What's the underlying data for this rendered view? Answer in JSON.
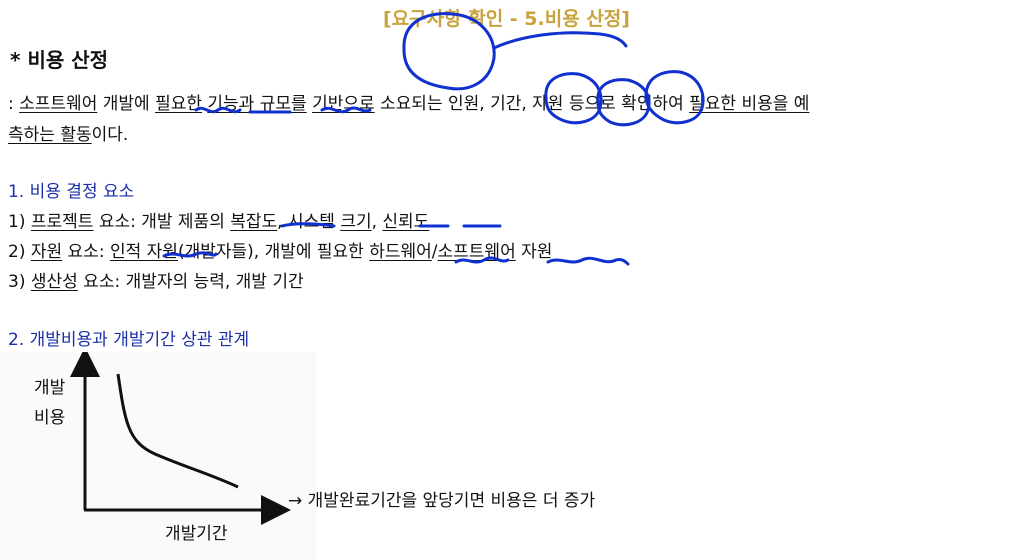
{
  "header": "[요구사항 확인 - 5.비용 산정]",
  "section": {
    "bullet": "*",
    "title": "비용 산정"
  },
  "definition": {
    "prefix": ": ",
    "line1": [
      {
        "text": "소프트웨어",
        "u": true
      },
      {
        "text": " 개발에 ",
        "u": false
      },
      {
        "text": "필요한",
        "u": true
      },
      {
        "text": " ",
        "u": false
      },
      {
        "text": "기능과",
        "u": true
      },
      {
        "text": " ",
        "u": false
      },
      {
        "text": "규모를",
        "u": true
      },
      {
        "text": " ",
        "u": false
      },
      {
        "text": "기반으로",
        "u": true
      },
      {
        "text": " 소요되는 인원, 기간, 자원 등으로 확인하여 ",
        "u": false
      },
      {
        "text": "필요한 비용을 예",
        "u": true
      }
    ],
    "line2": [
      {
        "text": "측하는 활동",
        "u": true
      },
      {
        "text": "이다.",
        "u": false
      }
    ]
  },
  "factors": {
    "heading": "1. 비용 결정 요소",
    "items": [
      [
        {
          "text": "1) ",
          "u": false
        },
        {
          "text": "프로젝트",
          "u": true
        },
        {
          "text": " 요소: 개발 제품의 ",
          "u": false
        },
        {
          "text": "복잡도",
          "u": true
        },
        {
          "text": ", 시스템 ",
          "u": false
        },
        {
          "text": "크기",
          "u": true
        },
        {
          "text": ", ",
          "u": false
        },
        {
          "text": "신뢰도",
          "u": true
        }
      ],
      [
        {
          "text": "2) ",
          "u": false
        },
        {
          "text": "자원",
          "u": true
        },
        {
          "text": "  요소: ",
          "u": false
        },
        {
          "text": "인적 자원",
          "u": true
        },
        {
          "text": "(개발자들), 개발에 필요한 ",
          "u": false
        },
        {
          "text": "하드웨어",
          "u": true
        },
        {
          "text": "/",
          "u": false
        },
        {
          "text": "소프트웨어",
          "u": true
        },
        {
          "text": " 자원",
          "u": false
        }
      ],
      [
        {
          "text": "3) ",
          "u": false
        },
        {
          "text": "생산성",
          "u": true
        },
        {
          "text": " 요소: 개발자의 능력, 개발 기간",
          "u": false
        }
      ]
    ]
  },
  "relation": {
    "heading": "2. 개발비용과 개발기간 상관 관계",
    "y_label_line1": "개발",
    "y_label_line2": "비용",
    "x_label": "개발기간",
    "note": "→ 개발완료기간을 앞당기면 비용은 더 증가"
  },
  "colors": {
    "header": "#c8a23c",
    "heading": "#1a2fa8",
    "ink": "#1030d0"
  }
}
